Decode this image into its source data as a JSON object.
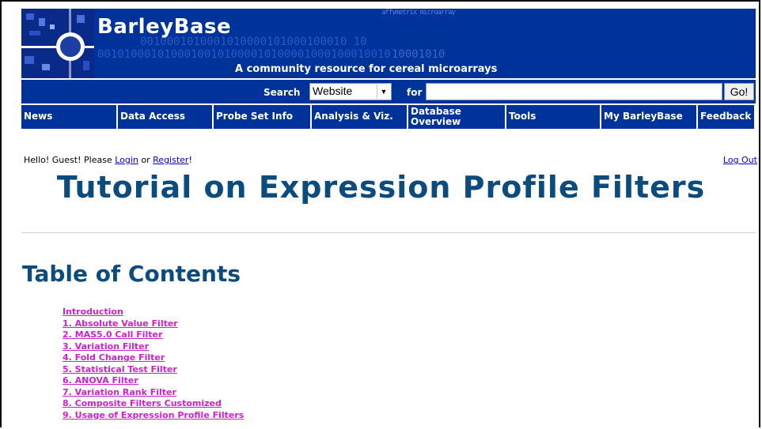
{
  "banner": {
    "brand": "BarleyBase",
    "tagline": "A community resource for cereal microarrays",
    "binary_line1": "0010001010001010000101000100010 10",
    "binary_line2": "00101000101000100101000010100001000100010010",
    "binary_line3": "10001010",
    "top_text": "affymetrix microarray"
  },
  "search": {
    "label": "Search",
    "selected_option": "Website",
    "for_label": "for",
    "query_value": "",
    "go_label": "Go!"
  },
  "nav": {
    "items": [
      {
        "label": "News"
      },
      {
        "label": "Data Access"
      },
      {
        "label": "Probe Set Info"
      },
      {
        "label": "Analysis & Viz."
      },
      {
        "label": "Database Overview"
      },
      {
        "label": "Tools"
      },
      {
        "label": "My BarleyBase"
      },
      {
        "label": "Feedback"
      }
    ]
  },
  "user": {
    "greeting_prefix": "Hello! Guest! Please",
    "login_label": "Login",
    "or_text": "or",
    "register_label": "Register",
    "suffix": "!",
    "logout_label": "Log Out"
  },
  "page": {
    "title": "Tutorial on Expression Profile Filters"
  },
  "toc": {
    "heading": "Table of Contents",
    "items": [
      "Introduction",
      "1. Absolute Value Filter",
      "2. MAS5.0 Call Filter",
      "3. Variation Filter",
      "4. Fold Change Filter",
      "5. Statistical Test Filter",
      "6. ANOVA Filter",
      "7. Variation Rank Filter",
      "8. Composite Filters Customized",
      "9. Usage of Expression Profile Filters"
    ]
  },
  "colors": {
    "banner_blue": "#00339a",
    "title_blue": "#0b4b7e",
    "toc_link": "#cc22cc",
    "link_blue": "#0000cc"
  }
}
